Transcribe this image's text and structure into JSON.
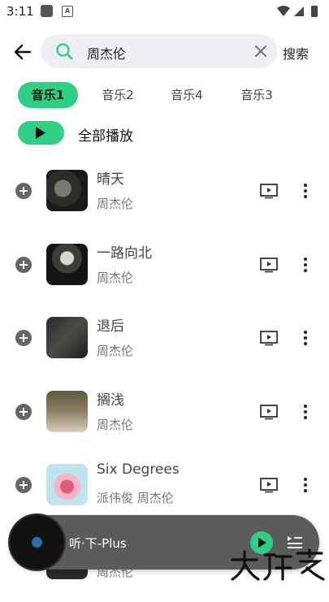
{
  "status_bar": {
    "time": "3:11"
  },
  "search": {
    "query": "周杰伦",
    "button_label": "搜索"
  },
  "tabs": [
    {
      "label": "音乐1",
      "active": true
    },
    {
      "label": "音乐2",
      "active": false
    },
    {
      "label": "音乐4",
      "active": false
    },
    {
      "label": "音乐3",
      "active": false
    }
  ],
  "play_all": {
    "label": "全部播放"
  },
  "songs": [
    {
      "title": "晴天",
      "artist": "周杰伦"
    },
    {
      "title": "一路向北",
      "artist": "周杰伦"
    },
    {
      "title": "退后",
      "artist": "周杰伦"
    },
    {
      "title": "搁浅",
      "artist": "周杰伦"
    },
    {
      "title": "Six Degrees",
      "artist": "派伟俊 周杰伦"
    },
    {
      "title": "",
      "artist": "周杰伦"
    }
  ],
  "player": {
    "name": "听·下-Plus"
  },
  "colors": {
    "accent": "#2ed184",
    "player_bg": "#5b5b5b"
  }
}
